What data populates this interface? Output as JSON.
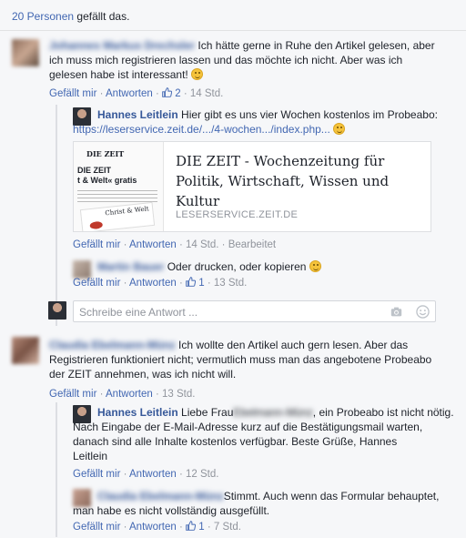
{
  "likes": {
    "count": "20 Personen",
    "suffix": " gefällt das."
  },
  "actions": {
    "like": "Gefällt mir",
    "reply": "Antworten",
    "edited": "Bearbeitet",
    "sep": " · "
  },
  "comments": [
    {
      "author": "Johannes Markus Drechsler",
      "text_line1": "Ich hätte gerne in Ruhe den Artikel gelesen, aber",
      "text_line2": "ich muss mich registrieren lassen und das möchte ich nicht. Aber was ich",
      "text_line3": "gelesen habe ist interessant!",
      "likes": "2",
      "time": "14 Std."
    },
    {
      "author": "Hannes Leitlein",
      "text_line1": "Hier gibt es uns vier Wochen kostenlos im Probeabo:",
      "link": "https://leserservice.zeit.de/.../4-wochen.../index.php...",
      "card": {
        "title": "DIE ZEIT - Wochenzeitung für Politik, Wirtschaft, Wissen und Kultur",
        "domain": "LESERSERVICE.ZEIT.DE",
        "thumb_header": "DIE ZEIT",
        "thumb_sub": "t & Welt« gratis",
        "thumb_caption": "Christ & Welt"
      },
      "time": "14 Std."
    },
    {
      "author": "Martin Bauer",
      "text": "Oder drucken, oder kopieren",
      "likes": "1",
      "time": "13 Std."
    },
    {
      "author": "Claudia Ebelmann-Münz",
      "text_line1": "Ich wollte den Artikel auch gern lesen. Aber das",
      "text_line2": "Registrieren funktioniert nicht; vermutlich muss man das angebotene Probeabo",
      "text_line3": "der ZEIT annehmen, was ich nicht will.",
      "time": "13 Std."
    },
    {
      "author": "Hannes Leitlein",
      "text_pre": "Liebe Frau",
      "text_blur": "Ebelmann-Münz",
      "text_post": ", ein Probeabo ist nicht nötig.",
      "text_line2": "Nach Eingabe der E-Mail-Adresse kurz auf die Bestätigungsmail warten,",
      "text_line3": "danach sind alle Inhalte kostenlos verfügbar. Beste Grüße, Hannes",
      "text_line4": "Leitlein",
      "time": "12 Std."
    },
    {
      "author": "Claudia Ebelmann-Münz",
      "text_line1": "Stimmt. Auch wenn das Formular behauptet,",
      "text_line2": "man habe es nicht vollständig ausgefüllt.",
      "likes": "1",
      "time": "7 Std."
    }
  ],
  "reply_box": {
    "placeholder": "Schreibe eine Antwort ..."
  },
  "icons": {
    "thumbs_up": "thumbs-up-icon",
    "camera": "camera-icon",
    "emoji": "emoji-icon"
  },
  "colors": {
    "link": "#4267b2",
    "name": "#365899",
    "meta": "#90949c",
    "bg": "#f6f7f9"
  }
}
